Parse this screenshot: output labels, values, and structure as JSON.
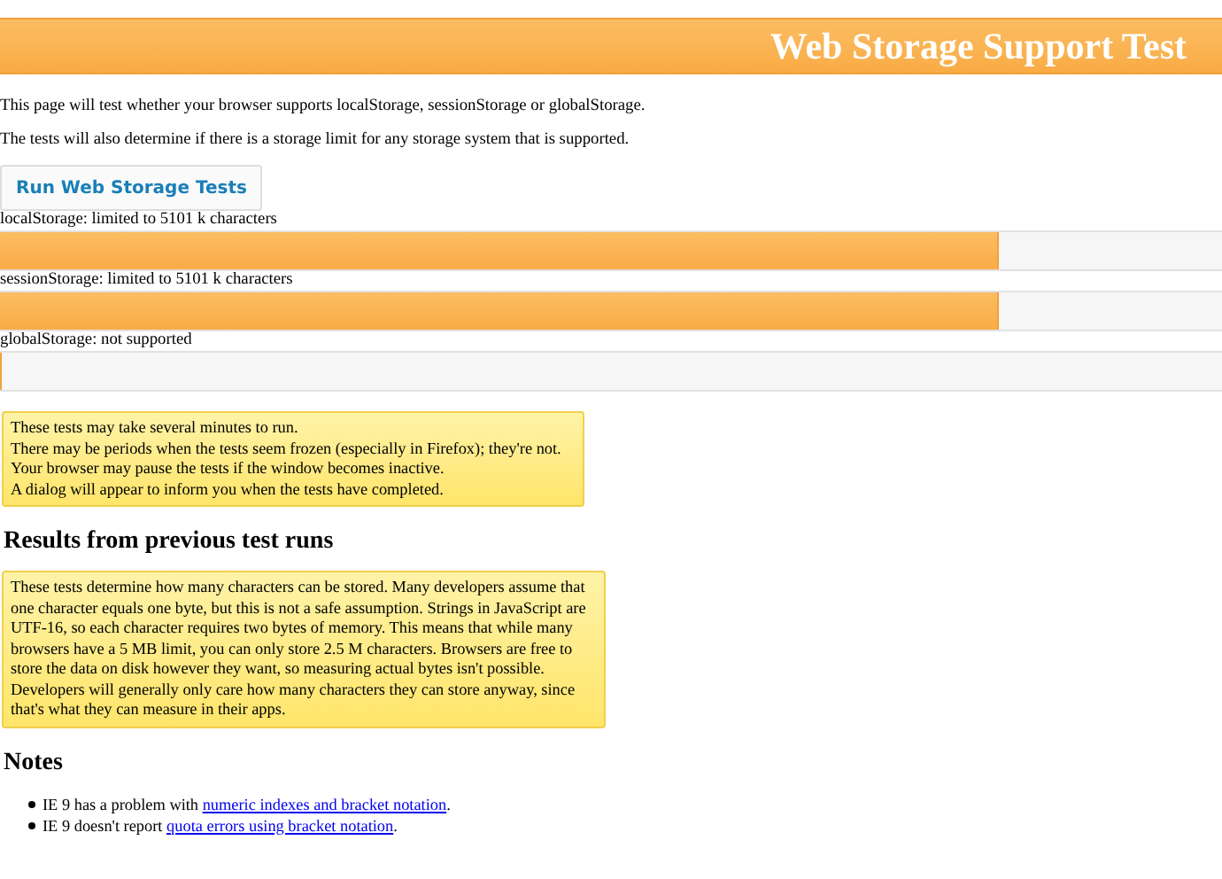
{
  "header": {
    "title": "Web Storage Support Test"
  },
  "intro": [
    "This page will test whether your browser supports localStorage, sessionStorage or globalStorage.",
    "The tests will also determine if there is a storage limit for any storage system that is supported."
  ],
  "run_button": {
    "label": "Run Web Storage Tests"
  },
  "storages": [
    {
      "label": "localStorage: limited to 5101 k characters",
      "level": 0.817
    },
    {
      "label": "sessionStorage: limited to 5101 k characters",
      "level": 0.817
    },
    {
      "label": "globalStorage: not supported",
      "level": 0
    }
  ],
  "warning": [
    "These tests may take several minutes to run.",
    "There may be periods when the tests seem frozen (especially in Firefox); they're not.",
    "Your browser may pause the tests if the window becomes inactive.",
    "A dialog will appear to inform you when the tests have completed."
  ],
  "results": {
    "heading": "Results from previous test runs",
    "text": "These tests determine how many characters can be stored. Many developers assume that one character equals one byte, but this is not a safe assumption. Strings in JavaScript are UTF-16, so each character requires two bytes of memory. This means that while many browsers have a 5 MB limit, you can only store 2.5 M characters. Browsers are free to store the data on disk however they want, so measuring actual bytes isn't possible. Developers will generally only care how many characters they can store anyway, since that's what they can measure in their apps."
  },
  "notes": {
    "heading": "Notes",
    "items": [
      {
        "before": "IE 9 has a problem with ",
        "link": "numeric indexes and bracket notation",
        "after": "."
      },
      {
        "before": "IE 9 doesn't report ",
        "link": "quota errors using bracket notation",
        "after": "."
      }
    ]
  }
}
